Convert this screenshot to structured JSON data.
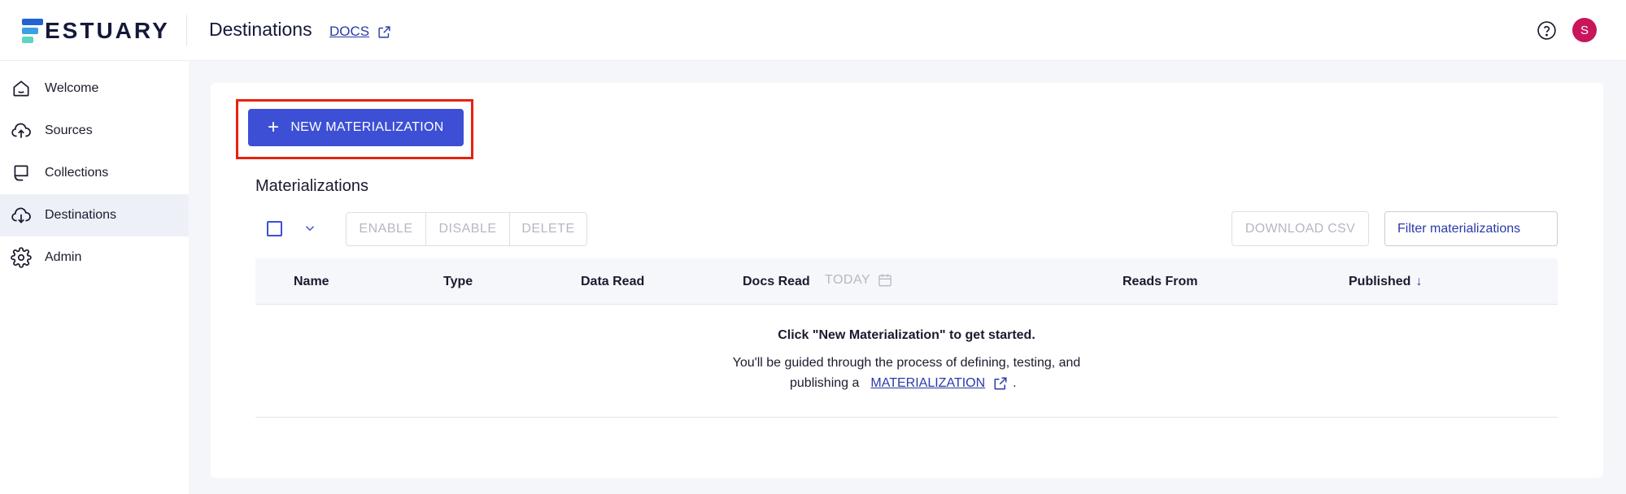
{
  "header": {
    "logo_text": "ESTUARY",
    "page_title": "Destinations",
    "docs_label": "DOCS",
    "avatar_initial": "S"
  },
  "sidebar": {
    "items": [
      {
        "label": "Welcome",
        "icon": "home-icon",
        "active": false
      },
      {
        "label": "Sources",
        "icon": "cloud-upload-icon",
        "active": false
      },
      {
        "label": "Collections",
        "icon": "collections-icon",
        "active": false
      },
      {
        "label": "Destinations",
        "icon": "cloud-download-icon",
        "active": true
      },
      {
        "label": "Admin",
        "icon": "gear-icon",
        "active": false
      }
    ]
  },
  "main": {
    "new_button_label": "NEW MATERIALIZATION",
    "section_title": "Materializations",
    "actions": {
      "enable": "ENABLE",
      "disable": "DISABLE",
      "delete": "DELETE",
      "download_csv": "DOWNLOAD CSV"
    },
    "filter": {
      "placeholder": "Filter materializations"
    },
    "table": {
      "columns": [
        "Name",
        "Type",
        "Data Read",
        "Docs Read",
        "Reads From",
        "Published"
      ],
      "date_filter": "TODAY",
      "sort_indicator": "↓"
    },
    "empty_state": {
      "title": "Click \"New Materialization\" to get started.",
      "line1": "You'll be guided through the process of defining, testing, and",
      "line2_prefix": "publishing a",
      "link_label": "MATERIALIZATION",
      "line2_suffix": "."
    }
  },
  "colors": {
    "accent": "#3d4fd4",
    "highlight_box": "#e8220e",
    "avatar": "#c8155c",
    "link": "#2b3aa6"
  }
}
